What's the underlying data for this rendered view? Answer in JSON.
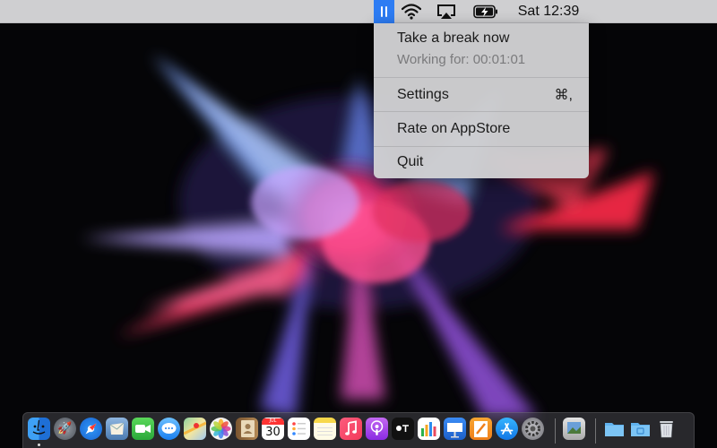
{
  "menubar": {
    "app_icon": "pause-icon",
    "clock": "Sat 12:39",
    "status_icons": [
      "wifi-icon",
      "airplay-icon",
      "battery-charging-icon"
    ]
  },
  "menu": {
    "take_break": "Take a break now",
    "working_for": "Working for: 00:01:01",
    "settings": "Settings",
    "settings_shortcut": "⌘,",
    "rate": "Rate on AppStore",
    "quit": "Quit"
  },
  "dock": {
    "calendar_month": "JUL",
    "calendar_day": "30",
    "apps": [
      "finder-icon",
      "launchpad-icon",
      "safari-icon",
      "mail-icon",
      "facetime-icon",
      "messages-icon",
      "maps-icon",
      "photos-icon",
      "contacts-icon",
      "calendar-icon",
      "reminders-icon",
      "notes-icon",
      "music-icon",
      "podcasts-icon",
      "tv-icon",
      "numbers-icon",
      "keynote-icon",
      "pages-icon",
      "app-store-icon",
      "system-preferences-icon",
      "preview-icon",
      "downloads-folder-icon",
      "documents-folder-icon",
      "trash-icon"
    ]
  },
  "colors": {
    "accent": "#2d7cf3",
    "menubar": "#d7d7da",
    "menu_bg": "#d0d0d2",
    "wallpaper": "#050507"
  }
}
